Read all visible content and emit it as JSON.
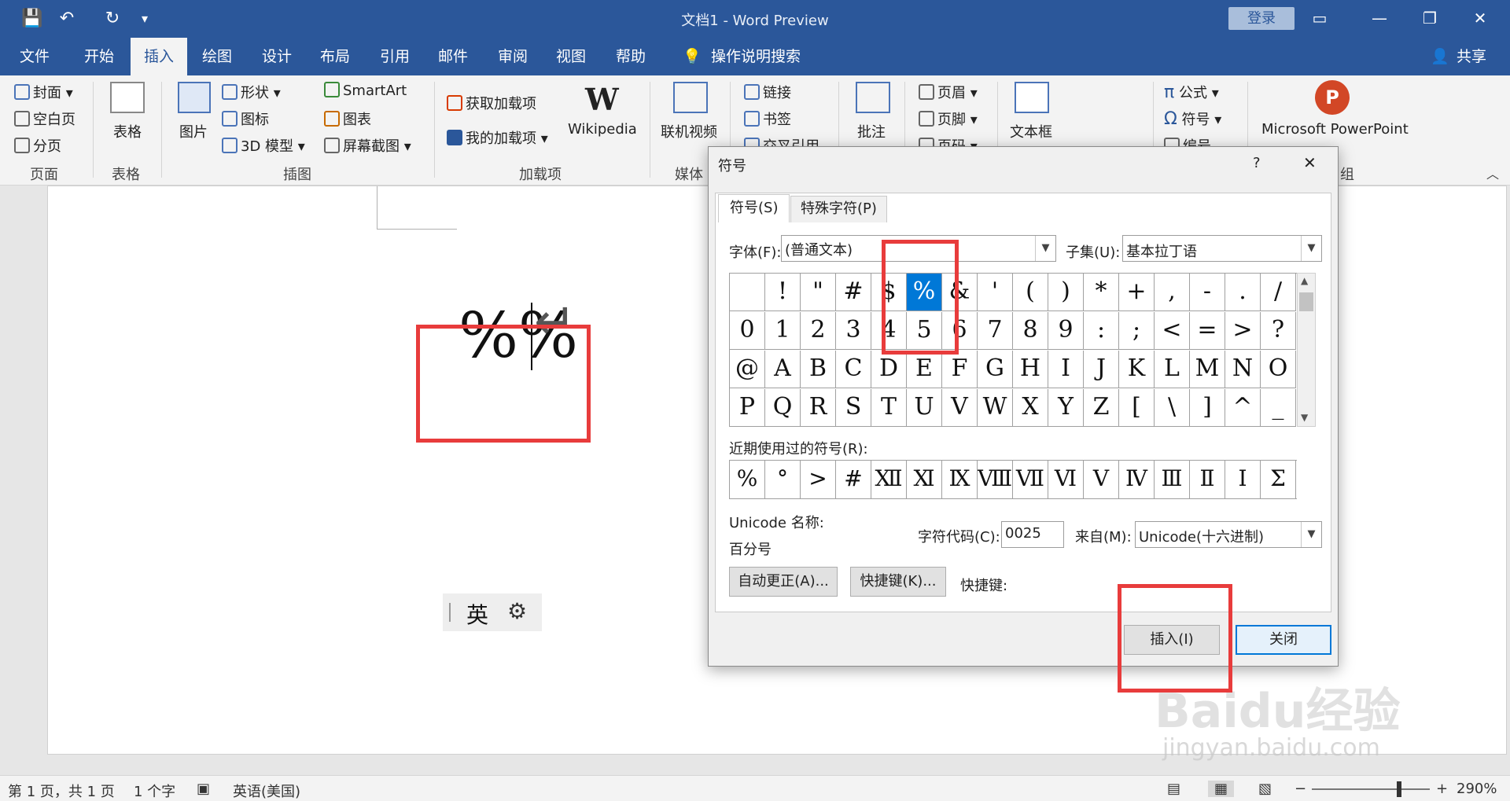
{
  "window": {
    "title": "文档1 - Word Preview",
    "login": "登录",
    "share": "共享"
  },
  "qat": [
    "💾",
    "↶",
    "↻",
    "▾"
  ],
  "menu": {
    "tabs": [
      "文件",
      "开始",
      "插入",
      "绘图",
      "设计",
      "布局",
      "引用",
      "邮件",
      "审阅",
      "视图",
      "帮助"
    ],
    "active": "插入",
    "tellme": "操作说明搜索"
  },
  "ribbon": {
    "pages": {
      "cover": "封面",
      "blank": "空白页",
      "break": "分页",
      "label": "页面"
    },
    "tables": {
      "table": "表格",
      "label": "表格"
    },
    "illustrations": {
      "picture": "图片",
      "shapes": "形状",
      "icons": "图标",
      "model3d": "3D 模型",
      "smartart": "SmartArt",
      "chart": "图表",
      "screenshot": "屏幕截图",
      "label": "插图"
    },
    "addins": {
      "get": "获取加载项",
      "my": "我的加载项",
      "wiki": "Wikipedia",
      "label": "加载项"
    },
    "media": {
      "video": "联机视频",
      "label": "媒体"
    },
    "links": {
      "link": "链接",
      "bookmark": "书签",
      "crossref": "交叉引用"
    },
    "comments": {
      "comment": "批注"
    },
    "header": {
      "header": "页眉",
      "footer": "页脚",
      "pagenum": "页码"
    },
    "text": {
      "textbox": "文本框"
    },
    "symbols": {
      "equation": "公式",
      "symbol": "符号",
      "number": "编号"
    },
    "ppt": {
      "label": "Microsoft PowerPoint",
      "group": "组"
    }
  },
  "doc": {
    "content": "%%",
    "ime_mode": "英"
  },
  "status": {
    "page": "第 1 页，共 1 页",
    "words": "1 个字",
    "lang": "英语(美国)",
    "zoom": "290%"
  },
  "dialog": {
    "title": "符号",
    "help": "?",
    "close": "✕",
    "tabs": [
      "符号(S)",
      "特殊字符(P)"
    ],
    "font_label": "字体(F):",
    "font_value": "(普通文本)",
    "subset_label": "子集(U):",
    "subset_value": "基本拉丁语",
    "grid": [
      [
        "",
        "!",
        "\"",
        "#",
        "$",
        "%",
        "&",
        "'",
        "(",
        ")",
        "*",
        "+",
        ",",
        "-",
        ".",
        "/"
      ],
      [
        "0",
        "1",
        "2",
        "3",
        "4",
        "5",
        "6",
        "7",
        "8",
        "9",
        ":",
        ";",
        "<",
        "=",
        ">",
        "?"
      ],
      [
        "@",
        "A",
        "B",
        "C",
        "D",
        "E",
        "F",
        "G",
        "H",
        "I",
        "J",
        "K",
        "L",
        "M",
        "N",
        "O"
      ],
      [
        "P",
        "Q",
        "R",
        "S",
        "T",
        "U",
        "V",
        "W",
        "X",
        "Y",
        "Z",
        "[",
        "\\",
        "]",
        "^",
        "_"
      ]
    ],
    "selected": "%",
    "recent_label": "近期使用过的符号(R):",
    "recent": [
      "%",
      "°",
      ">",
      "#",
      "Ⅻ",
      "Ⅺ",
      "Ⅸ",
      "Ⅷ",
      "Ⅶ",
      "Ⅵ",
      "Ⅴ",
      "Ⅳ",
      "Ⅲ",
      "Ⅱ",
      "Ⅰ",
      "Σ"
    ],
    "unicode_label": "Unicode 名称:",
    "unicode_name": "百分号",
    "charcode_label": "字符代码(C):",
    "charcode_value": "0025",
    "from_label": "来自(M):",
    "from_value": "Unicode(十六进制)",
    "autocorrect": "自动更正(A)...",
    "shortcut_btn": "快捷键(K)...",
    "shortcut_label": "快捷键:",
    "insert": "插入(I)",
    "close_btn": "关闭"
  },
  "watermark": {
    "logo": "Baidu经验",
    "url": "jingyan.baidu.com"
  },
  "colors": {
    "brand": "#2b579a",
    "highlight": "#e83c3c",
    "selection": "#0078d7"
  }
}
